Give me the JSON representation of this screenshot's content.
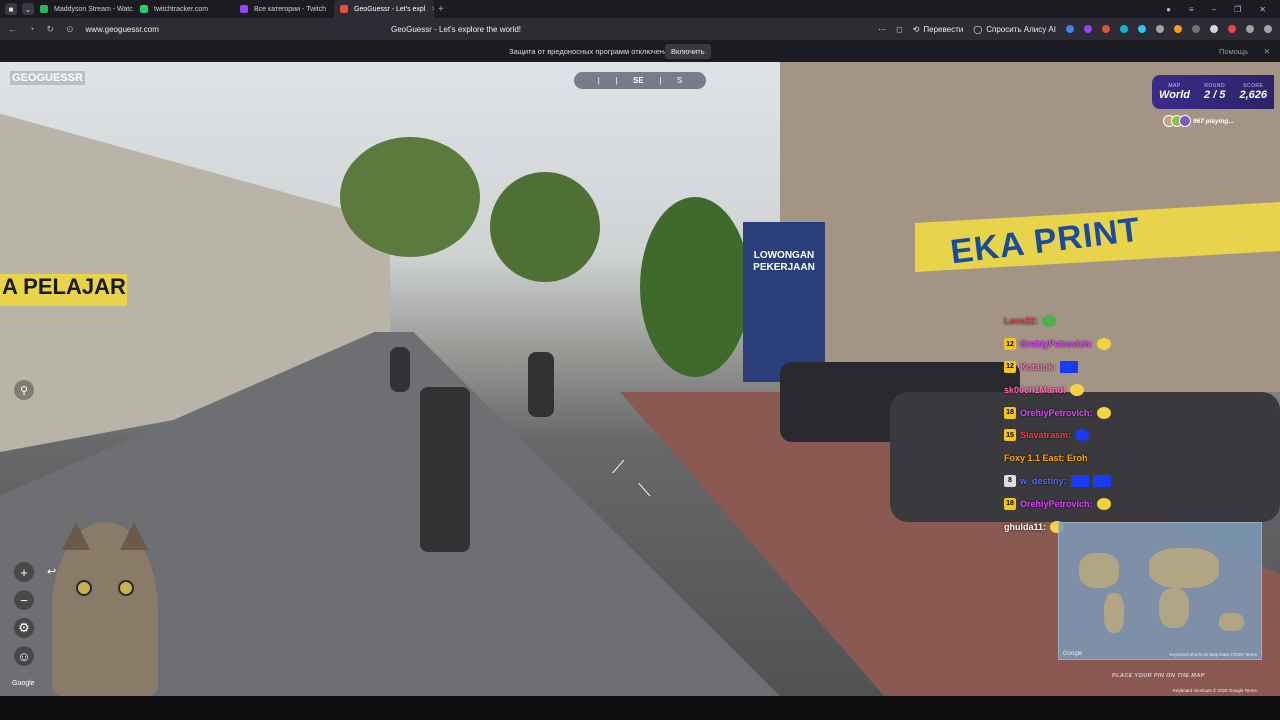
{
  "browser": {
    "tabs": [
      {
        "label": "Maddyson Stream - Watc",
        "fav_color": "#28b463"
      },
      {
        "label": "twitchtracker.com",
        "fav_color": "#2ecc71"
      },
      {
        "label": "Все категории - Twitch",
        "fav_color": "#9146ff"
      },
      {
        "label": "GeoGuessr - Let's expl",
        "fav_color": "#e74c3c",
        "active": true
      }
    ],
    "url": "www.geoguessr.com",
    "page_title": "GeoGuessr - Let's explore the world!",
    "translate_label": "Перевести",
    "alice_label": "Спросить Алису AI",
    "protection_message": "Защита от вредоносных программ отключена",
    "protection_button": "Включить",
    "help_label": "Помощь"
  },
  "game": {
    "logo": "GEOGUESSR",
    "compass_direction": "SE",
    "compass_extra": "S",
    "map_label": "MAP",
    "map_value": "World",
    "round_label": "ROUND",
    "round_value": "2 / 5",
    "score_label": "SCORE",
    "score_value": "2,626",
    "playing_text": "967 playing...",
    "place_pin_hint": "PLACE YOUR PIN ON THE MAP",
    "google_mark": "Google",
    "map_google": "Google",
    "map_meta": "Keyboard shortcuts  Map Data ©2026  Terms",
    "footer_terms": "Keyboard shortcuts   © 2026 Google   Terms"
  },
  "scene": {
    "sign_eka": "EKA PRINT",
    "sign_lowongan": "LOWONGAN PEKERJAAN",
    "sign_pelajar": "A PELAJAR"
  },
  "chat": [
    {
      "badge": "",
      "user": "Luce22:",
      "color": "#ff3b3b"
    },
    {
      "badge": "12",
      "user": "OrehiyPetrovich:",
      "color": "#e040fb"
    },
    {
      "badge": "12",
      "user": "Kotaiuk:",
      "color": "#ff69b4"
    },
    {
      "badge": "",
      "user": "sk00ch1Mand:",
      "color": "#ff69b4"
    },
    {
      "badge": "18",
      "user": "OrehiyPetrovich:",
      "color": "#e040fb"
    },
    {
      "badge": "15",
      "user": "Slavatrasm:",
      "color": "#ff3b3b"
    },
    {
      "badge": "",
      "user": "Foxy 1.1 East: Eroh",
      "color": "#ffa500"
    },
    {
      "badge": "8",
      "user": "w_destiny:",
      "color": "#4c6bff"
    },
    {
      "badge": "18",
      "user": "OrehiyPetrovich:",
      "color": "#e040fb"
    },
    {
      "badge": "",
      "user": "ghulda11:",
      "color": "#ffffff"
    }
  ]
}
